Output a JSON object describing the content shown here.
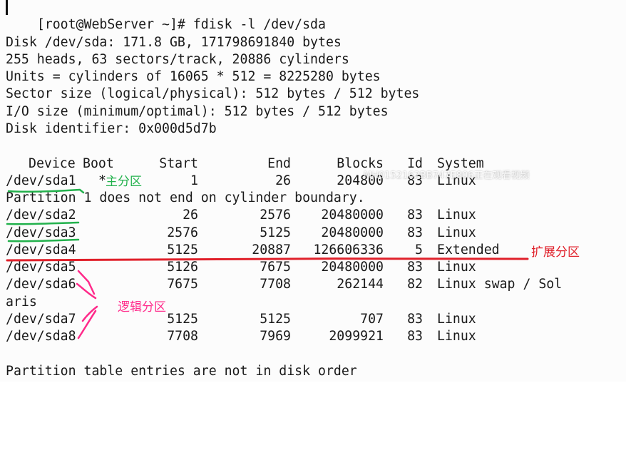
{
  "prompt": "[root@WebServer ~]# fdisk -l /dev/sda",
  "disk_info": [
    "Disk /dev/sda: 171.8 GB, 171798691840 bytes",
    "255 heads, 63 sectors/track, 20886 cylinders",
    "Units = cylinders of 16065 * 512 = 8225280 bytes",
    "Sector size (logical/physical): 512 bytes / 512 bytes",
    "I/O size (minimum/optimal): 512 bytes / 512 bytes",
    "Disk identifier: 0x000d5d7b"
  ],
  "table": {
    "headers": {
      "device": "Device",
      "boot": "Boot",
      "start": "Start",
      "end": "End",
      "blocks": "Blocks",
      "id": "Id",
      "system": "System"
    },
    "rows": [
      {
        "device": "/dev/sda1",
        "boot": "*",
        "start": "1",
        "end": "26",
        "blocks": "204800",
        "id": "83",
        "system": "Linux"
      },
      {
        "device": "/dev/sda2",
        "boot": "",
        "start": "26",
        "end": "2576",
        "blocks": "20480000",
        "id": "83",
        "system": "Linux"
      },
      {
        "device": "/dev/sda3",
        "boot": "",
        "start": "2576",
        "end": "5125",
        "blocks": "20480000",
        "id": "83",
        "system": "Linux"
      },
      {
        "device": "/dev/sda4",
        "boot": "",
        "start": "5125",
        "end": "20887",
        "blocks": "126606336",
        "id": "5",
        "system": "Extended"
      },
      {
        "device": "/dev/sda5",
        "boot": "",
        "start": "5126",
        "end": "7675",
        "blocks": "20480000",
        "id": "83",
        "system": "Linux"
      },
      {
        "device": "/dev/sda6",
        "boot": "",
        "start": "7675",
        "end": "7708",
        "blocks": "262144",
        "id": "82",
        "system": "Linux swap / Sol"
      },
      {
        "device": "/dev/sda7",
        "boot": "",
        "start": "5125",
        "end": "5125",
        "blocks": "707",
        "id": "83",
        "system": "Linux"
      },
      {
        "device": "/dev/sda8",
        "boot": "",
        "start": "7708",
        "end": "7969",
        "blocks": "2099921",
        "id": "83",
        "system": "Linux"
      }
    ],
    "partition_warning": "Partition 1 does not end on cylinder boundary.",
    "wrap_continuation": "aris"
  },
  "footer": "Partition table entries are not in disk order",
  "annotations": {
    "primary": "主分区",
    "extended": "扩展分区",
    "logical": "逻辑分区"
  },
  "watermark": "MH0152162BB747E806正在观看视频",
  "colors": {
    "green": "#22b14c",
    "red": "#e0202a",
    "pink": "#ff2a8a",
    "text": "#1a1a1a",
    "background": "#fcfcfc"
  }
}
